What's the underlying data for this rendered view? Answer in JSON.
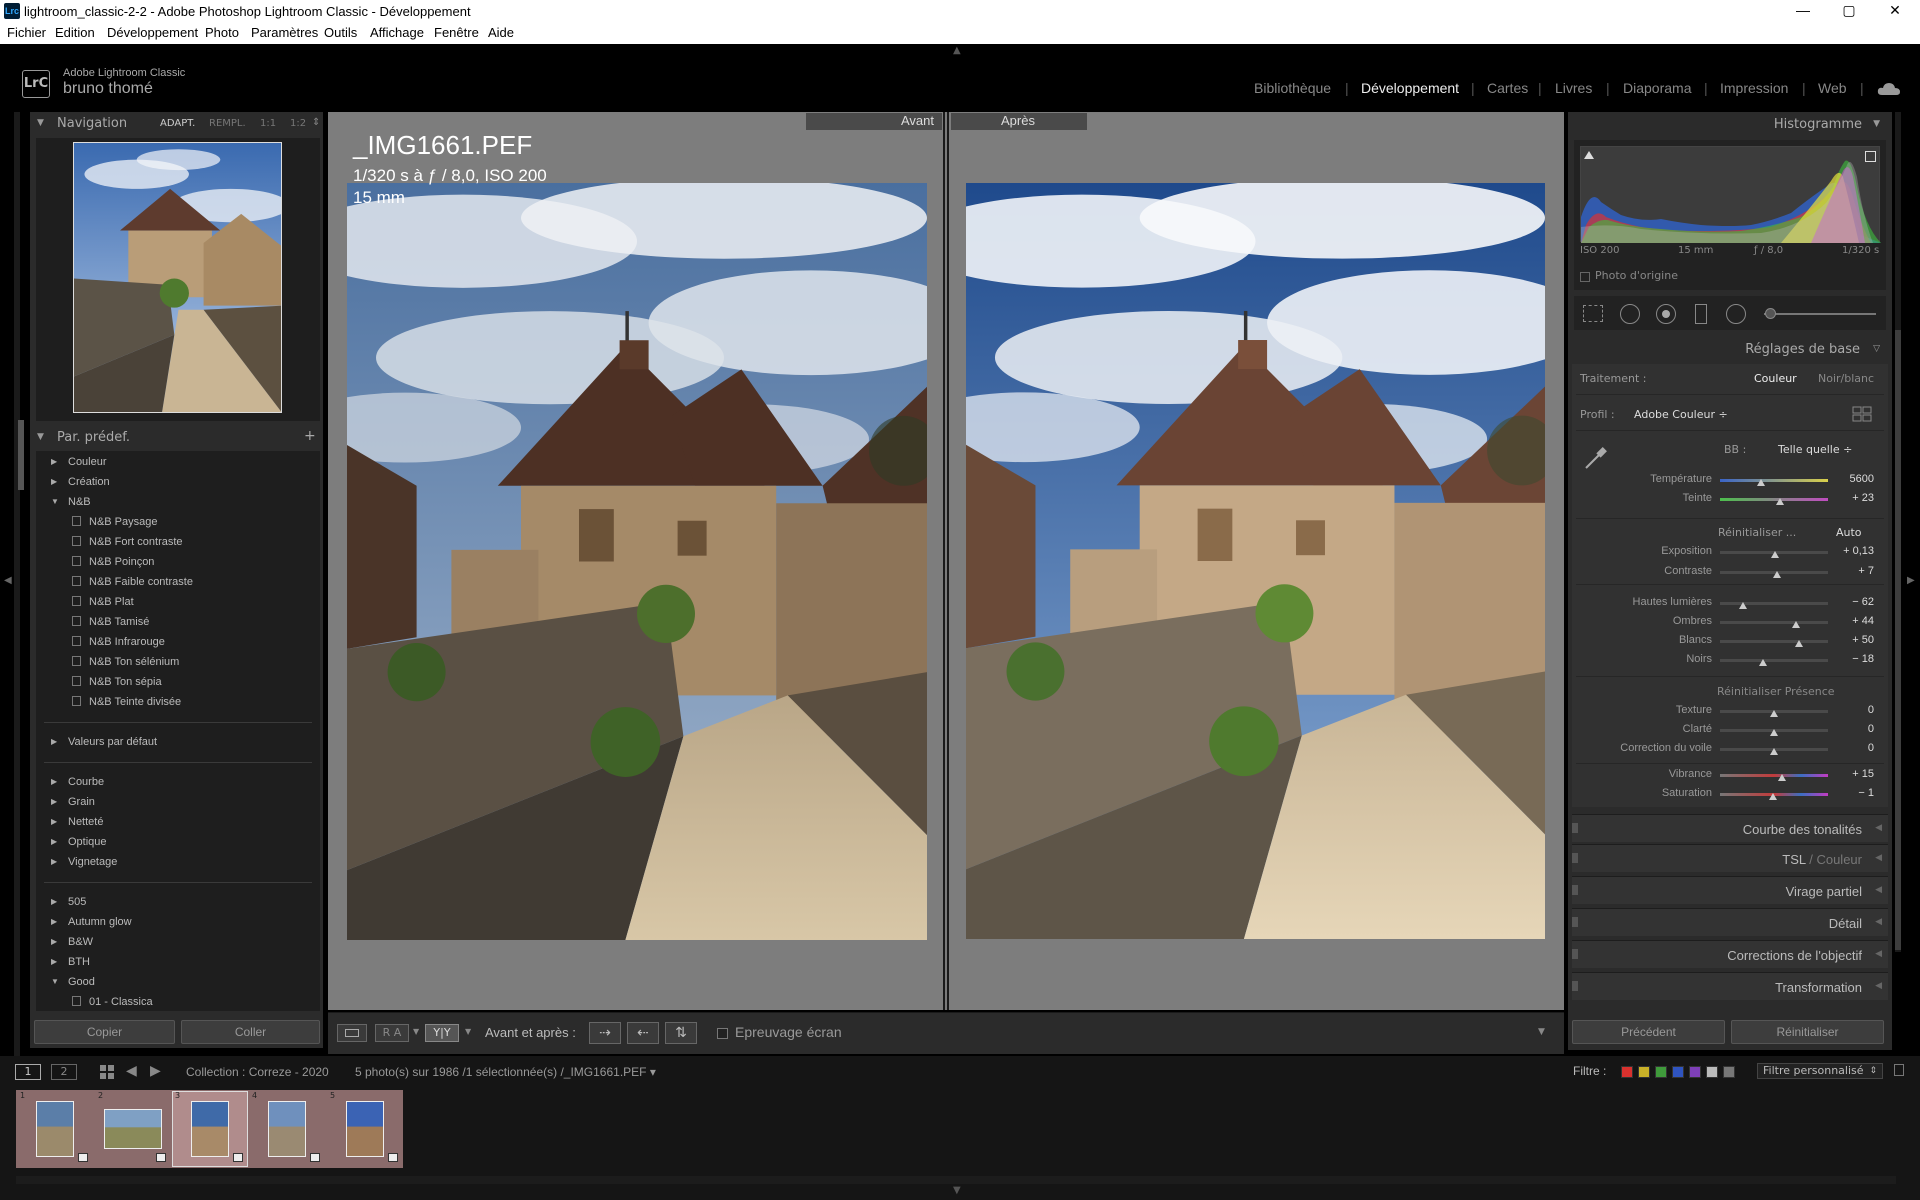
{
  "window": {
    "title": "lightroom_classic-2-2 - Adobe Photoshop Lightroom Classic - Développement",
    "app_icon": "Lrc",
    "controls": [
      "—",
      "▢",
      "✕"
    ]
  },
  "menu": [
    "Fichier",
    "Edition",
    "Développement",
    "Photo",
    "Paramètres",
    "Outils",
    "Affichage",
    "Fenêtre",
    "Aide"
  ],
  "identity": {
    "logo": "LrC",
    "product": "Adobe Lightroom Classic",
    "user": "bruno thomé"
  },
  "modules": [
    "Bibliothèque",
    "Développement",
    "Cartes",
    "Livres",
    "Diaporama",
    "Impression",
    "Web"
  ],
  "active_module": "Développement",
  "navigator": {
    "title": "Navigation",
    "zoom_options": [
      "ADAPT.",
      "REMPL.",
      "1:1",
      "1:2"
    ],
    "zoom_arrows": "⇕"
  },
  "presets": {
    "title": "Par. prédef.",
    "add": "+",
    "groups": [
      {
        "label": "Couleur",
        "open": false
      },
      {
        "label": "Création",
        "open": false
      },
      {
        "label": "N&B",
        "open": true,
        "items": [
          "N&B Paysage",
          "N&B Fort contraste",
          "N&B Poinçon",
          "N&B Faible contraste",
          "N&B Plat",
          "N&B Tamisé",
          "N&B Infrarouge",
          "N&B Ton sélénium",
          "N&B Ton sépia",
          "N&B Teinte divisée"
        ]
      },
      {
        "label": "Valeurs par défaut",
        "open": false
      },
      {
        "label": "Courbe",
        "open": false
      },
      {
        "label": "Grain",
        "open": false
      },
      {
        "label": "Netteté",
        "open": false
      },
      {
        "label": "Optique",
        "open": false
      },
      {
        "label": "Vignetage",
        "open": false
      },
      {
        "label": "505",
        "open": false
      },
      {
        "label": "Autumn glow",
        "open": false
      },
      {
        "label": "B&W",
        "open": false
      },
      {
        "label": "BTH",
        "open": false
      },
      {
        "label": "Good",
        "open": true,
        "items": [
          "01 - Classica"
        ]
      }
    ]
  },
  "left_buttons": {
    "copy": "Copier",
    "paste": "Coller"
  },
  "compare": {
    "before": "Avant",
    "after": "Après",
    "filename": "_IMG1661.PEF",
    "exposure_info": "1/320 s à ƒ / 8,0, ISO 200",
    "focal": "15 mm"
  },
  "toolbar": {
    "view_ra": "R A",
    "view_yy": "Y|Y",
    "before_after_label": "Avant et après :",
    "soft_proof": "Epreuvage écran"
  },
  "histogram": {
    "title": "Histogramme",
    "iso": "ISO 200",
    "focal": "15 mm",
    "aperture": "ƒ / 8,0",
    "shutter": "1/320 s",
    "original_photo": "Photo d'origine"
  },
  "basic": {
    "title": "Réglages de base",
    "treatment_label": "Traitement :",
    "treatment_color": "Couleur",
    "treatment_bw": "Noir/blanc",
    "profile_label": "Profil :",
    "profile_value": "Adobe Couleur ÷",
    "wb_label": "BB :",
    "wb_value": "Telle quelle ÷",
    "temp": {
      "label": "Température",
      "value": "5600",
      "pos": 0.38
    },
    "tint": {
      "label": "Teinte",
      "value": "+ 23",
      "pos": 0.56
    },
    "tone_reset": "Réinitialiser ...",
    "auto": "Auto",
    "tone": [
      {
        "label": "Exposition",
        "value": "+ 0,13",
        "pos": 0.51
      },
      {
        "label": "Contraste",
        "value": "+ 7",
        "pos": 0.53
      }
    ],
    "tone2": [
      {
        "label": "Hautes lumières",
        "value": "− 62",
        "pos": 0.21
      },
      {
        "label": "Ombres",
        "value": "+ 44",
        "pos": 0.7
      },
      {
        "label": "Blancs",
        "value": "+ 50",
        "pos": 0.73
      },
      {
        "label": "Noirs",
        "value": "− 18",
        "pos": 0.4
      }
    ],
    "presence_reset": "Réinitialiser Présence",
    "presence": [
      {
        "label": "Texture",
        "value": "0",
        "pos": 0.5
      },
      {
        "label": "Clarté",
        "value": "0",
        "pos": 0.5
      },
      {
        "label": "Correction du voile",
        "value": "0",
        "pos": 0.5
      }
    ],
    "presence2": [
      {
        "label": "Vibrance",
        "value": "+ 15",
        "pos": 0.57
      },
      {
        "label": "Saturation",
        "value": "− 1",
        "pos": 0.495
      }
    ]
  },
  "right_panels": [
    "Courbe des tonalités",
    "TSL / Couleur",
    "Virage partiel",
    "Détail",
    "Corrections de l'objectif",
    "Transformation"
  ],
  "tsl_bold": "TSL",
  "tsl_rest": " / Couleur",
  "right_buttons": {
    "previous": "Précédent",
    "reset": "Réinitialiser"
  },
  "filmstrip": {
    "monitor1": "1",
    "monitor2": "2",
    "source": "Collection : Correze - 2020",
    "count": "5 photo(s) sur 1986 /1 sélectionnée(s) /_IMG1661.PEF ▾",
    "filter_label": "Filtre :",
    "filter_value": "Filtre personnalisé",
    "filter_colors": [
      "#d9312e",
      "#c9b128",
      "#3f9a3b",
      "#2f54c0",
      "#7e3fb8",
      "#bbbbbb",
      "#777777"
    ],
    "thumbs": [
      "1",
      "2",
      "3",
      "4",
      "5"
    ]
  }
}
